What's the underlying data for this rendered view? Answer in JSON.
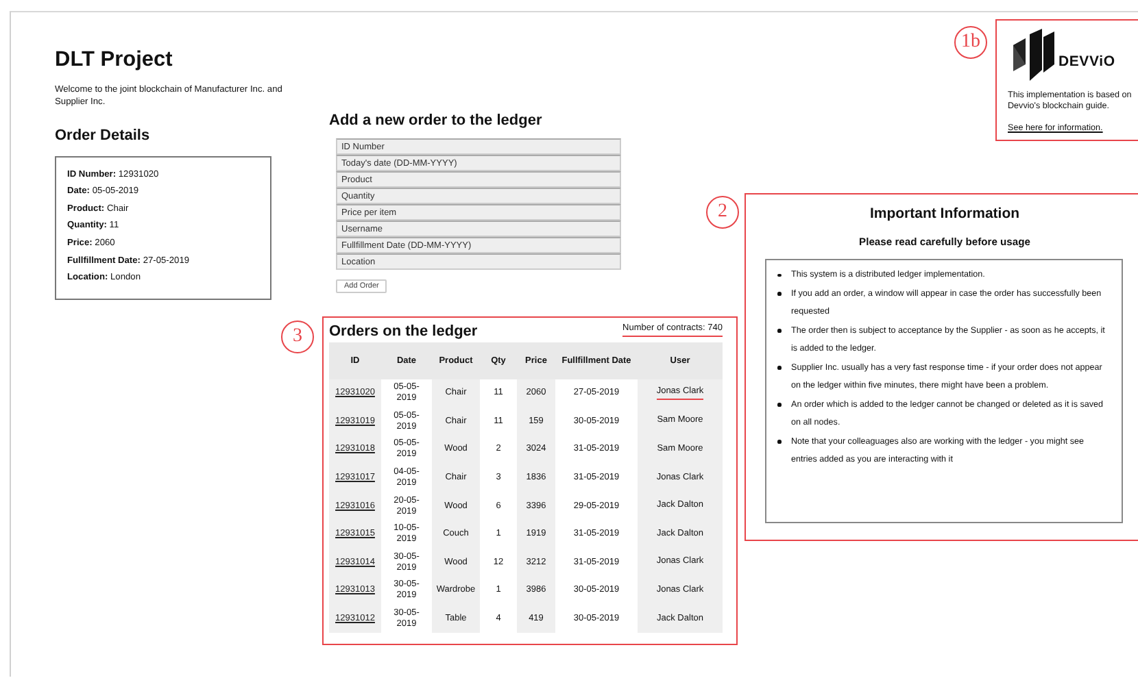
{
  "title": "DLT Project",
  "welcome": "Welcome to the joint blockchain of Manufacturer Inc. and Supplier Inc.",
  "order_details": {
    "heading": "Order Details",
    "fields": [
      "**ID Number:** 12931020",
      "**Date:** 05-05-2019",
      "**Product:** Chair",
      "**Quantity:** 11",
      "**Price:** 2060",
      "**Fullfillment Date:** 27-05-2019",
      "**Location:** London"
    ]
  },
  "new_order": {
    "heading": "Add a new order to the ledger",
    "inputs": [
      {
        "placeholder": "ID Number"
      },
      {
        "placeholder": "Today's date (DD-MM-YYYY)"
      },
      {
        "placeholder": "Product"
      },
      {
        "placeholder": "Quantity"
      },
      {
        "placeholder": "Price per item"
      },
      {
        "placeholder": "Username"
      },
      {
        "placeholder": "Fullfillment Date (DD-MM-YYYY)"
      },
      {
        "placeholder": "Location"
      }
    ],
    "button": "Add Order"
  },
  "ledger": {
    "annotation": "3",
    "heading": "Orders on the ledger",
    "contract_count": {
      "text": "Number of contracts: 740",
      "marked": true
    },
    "columns": [
      "ID",
      "Date",
      "Product",
      "Qty",
      "Price",
      "Fullfillment Date",
      "User"
    ],
    "rows": [
      {
        "cells": [
          "12931020",
          "05-05-2019",
          "Chair",
          "11",
          "2060",
          "27-05-2019",
          "Jonas Clark"
        ],
        "user_marked": true
      },
      {
        "cells": [
          "12931019",
          "05-05-2019",
          "Chair",
          "11",
          "159",
          "30-05-2019",
          "Sam Moore"
        ],
        "user_marked": false
      },
      {
        "cells": [
          "12931018",
          "05-05-2019",
          "Wood",
          "2",
          "3024",
          "31-05-2019",
          "Sam Moore"
        ],
        "user_marked": false
      },
      {
        "cells": [
          "12931017",
          "04-05-2019",
          "Chair",
          "3",
          "1836",
          "31-05-2019",
          "Jonas Clark"
        ],
        "user_marked": false
      },
      {
        "cells": [
          "12931016",
          "20-05-2019",
          "Wood",
          "6",
          "3396",
          "29-05-2019",
          "Jack Dalton"
        ],
        "user_marked": false
      },
      {
        "cells": [
          "12931015",
          "10-05-2019",
          "Couch",
          "1",
          "1919",
          "31-05-2019",
          "Jack Dalton"
        ],
        "user_marked": false
      },
      {
        "cells": [
          "12931014",
          "30-05-2019",
          "Wood",
          "12",
          "3212",
          "31-05-2019",
          "Jonas Clark"
        ],
        "user_marked": false
      },
      {
        "cells": [
          "12931013",
          "30-05-2019",
          "Wardrobe",
          "1",
          "3986",
          "30-05-2019",
          "Jonas Clark"
        ],
        "user_marked": false
      },
      {
        "cells": [
          "12931012",
          "30-05-2019",
          "Table",
          "4",
          "419",
          "30-05-2019",
          "Jack Dalton"
        ],
        "user_marked": false
      }
    ]
  },
  "brand": {
    "annotation": "1b",
    "logo_text": "DEVViO",
    "text": "This implementation is based on Devvio's blockchain guide.",
    "link": "See here for information."
  },
  "info": {
    "annotation": "2",
    "heading": "Important Information",
    "subheading": "Please read carefully before usage",
    "items": [
      "This system is a distributed ledger implementation.",
      "If you add an order, a window will appear in case the order has successfully been requested",
      "The order then is subject to acceptance by the Supplier - as soon as he accepts, it is added to the ledger.",
      "Supplier Inc. usually has a very fast response time - if your order does not appear on the ledger within five minutes, there might have been a problem.",
      "An order which is added to the ledger cannot be changed or deleted as it is saved on all nodes.",
      "Note that your colleaguages also are working with the ledger - you might see entries added as you are interacting with it"
    ]
  }
}
